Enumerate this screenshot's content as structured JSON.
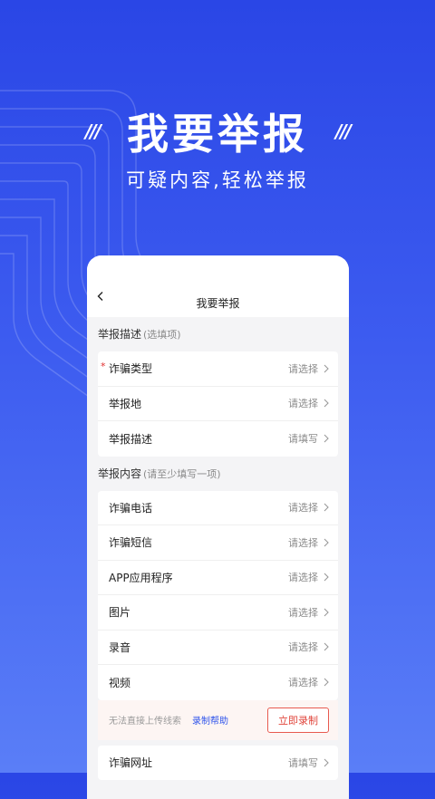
{
  "hero": {
    "title": "我要举报",
    "subtitle": "可疑内容,轻松举报",
    "slash_left": "///",
    "slash_right": "///"
  },
  "screen": {
    "nav_title": "我要举报",
    "section1": {
      "title": "举报描述",
      "hint": "(选填项)"
    },
    "section1_rows": [
      {
        "label": "诈骗类型",
        "value": "请选择",
        "required": true
      },
      {
        "label": "举报地",
        "value": "请选择"
      },
      {
        "label": "举报描述",
        "value": "请填写"
      }
    ],
    "section2": {
      "title": "举报内容",
      "hint": "(请至少填写一项)"
    },
    "section2_rows": [
      {
        "label": "诈骗电话",
        "value": "请选择"
      },
      {
        "label": "诈骗短信",
        "value": "请选择"
      },
      {
        "label": "APP应用程序",
        "value": "请选择"
      },
      {
        "label": "图片",
        "value": "请选择"
      },
      {
        "label": "录音",
        "value": "请选择"
      },
      {
        "label": "视频",
        "value": "请选择"
      }
    ],
    "record_bar": {
      "hint": "无法直接上传线索",
      "help": "录制帮助",
      "button": "立即录制"
    },
    "section3_rows": [
      {
        "label": "诈骗网址",
        "value": "请填写"
      }
    ],
    "required_mark": "*"
  },
  "colors": {
    "accent": "#2f54eb",
    "danger": "#e0443a"
  },
  "icons": {
    "back": "chevron-left-icon",
    "row_arrow": "chevron-right-icon"
  }
}
